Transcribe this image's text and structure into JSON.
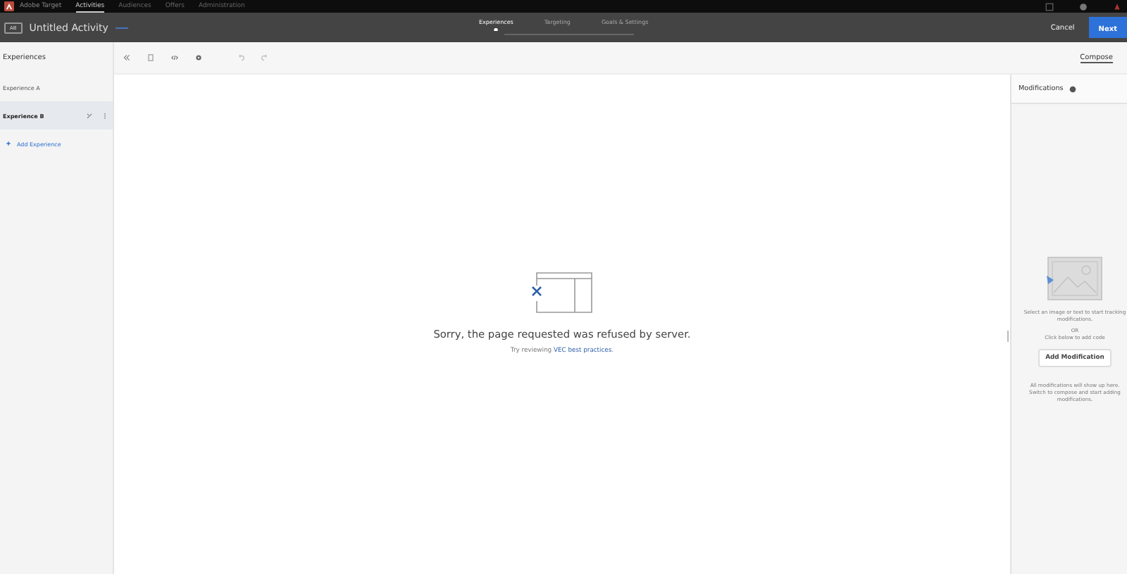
{
  "topnav": {
    "brand": "Adobe Target",
    "items": [
      {
        "label": "Activities",
        "selected": true
      },
      {
        "label": "Audiences",
        "selected": false
      },
      {
        "label": "Offers",
        "selected": false
      },
      {
        "label": "Administration",
        "selected": false
      }
    ]
  },
  "header": {
    "badge": "AB",
    "title": "Untitled Activity",
    "steps": [
      {
        "label": "Experiences",
        "selected": true
      },
      {
        "label": "Targeting",
        "selected": false
      },
      {
        "label": "Goals & Settings",
        "selected": false
      }
    ],
    "cancel": "Cancel",
    "next": "Next"
  },
  "sidebar": {
    "title": "Experiences",
    "items": [
      {
        "label": "Experience A",
        "selected": false
      },
      {
        "label": "Experience B",
        "selected": true
      }
    ],
    "add": "Add Experience"
  },
  "compose_tab": "Compose",
  "error": {
    "message": "Sorry, the page requested was refused by server.",
    "hint": "Try reviewing",
    "link": "VEC best practices",
    "after": "."
  },
  "modifications": {
    "title": "Modifications",
    "hint": "Select an image or text to start tracking",
    "hint_2": "modifications.",
    "or": "OR",
    "code_hint": "Click below to add code",
    "button": "Add Modification",
    "footer": [
      "All modifications will show up here.",
      "Switch to compose and start adding",
      "modifications."
    ]
  }
}
